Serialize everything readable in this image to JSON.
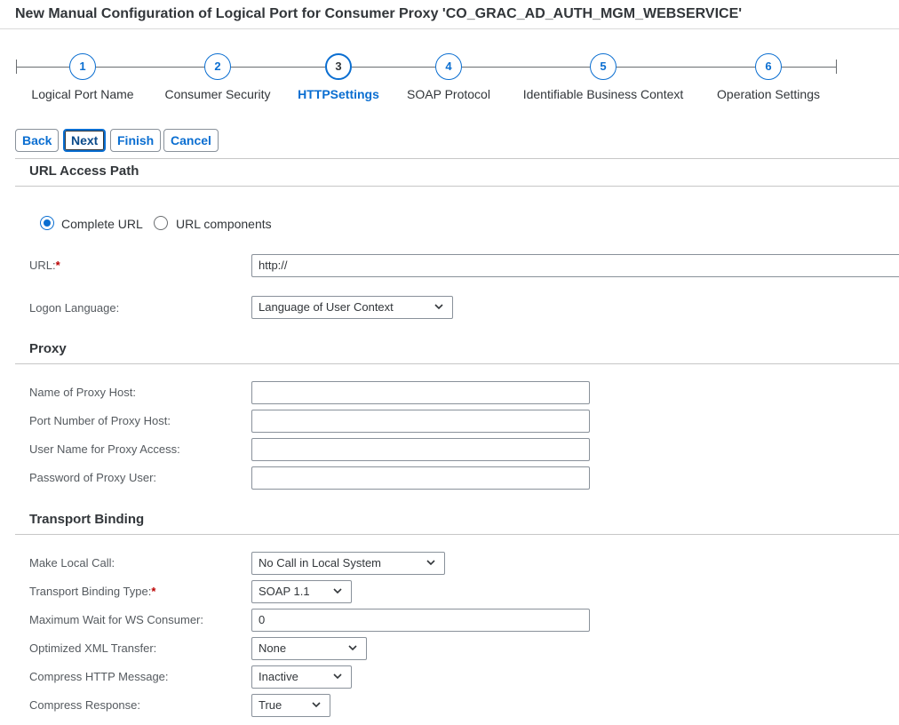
{
  "page": {
    "title": "New Manual Configuration of Logical Port for Consumer Proxy 'CO_GRAC_AD_AUTH_MGM_WEBSERVICE'"
  },
  "wizard": {
    "current_step": 3,
    "steps": [
      {
        "number": "1",
        "label": "Logical Port Name"
      },
      {
        "number": "2",
        "label": "Consumer Security"
      },
      {
        "number": "3",
        "label": "HTTPSettings"
      },
      {
        "number": "4",
        "label": "SOAP Protocol"
      },
      {
        "number": "5",
        "label": "Identifiable Business Context"
      },
      {
        "number": "6",
        "label": "Operation Settings"
      }
    ]
  },
  "toolbar": {
    "back": "Back",
    "next": "Next",
    "finish": "Finish",
    "cancel": "Cancel"
  },
  "url_access": {
    "title": "URL Access Path",
    "options": [
      "Complete URL",
      "URL components"
    ],
    "selected": "Complete URL",
    "url_label": "URL:",
    "url_required": "*",
    "url_value": "http://",
    "logon_language_label": "Logon Language:",
    "logon_language_value": "Language of User Context"
  },
  "proxy": {
    "title": "Proxy",
    "fields": [
      {
        "label": "Name of Proxy Host:",
        "value": ""
      },
      {
        "label": "Port Number of Proxy Host:",
        "value": ""
      },
      {
        "label": "User Name for Proxy Access:",
        "value": ""
      },
      {
        "label": "Password of Proxy User:",
        "value": ""
      }
    ]
  },
  "transport": {
    "title": "Transport Binding",
    "make_local_call": {
      "label": "Make Local Call:",
      "value": "No Call in Local System"
    },
    "binding_type": {
      "label": "Transport Binding Type:",
      "required": "*",
      "value": "SOAP 1.1"
    },
    "max_wait": {
      "label": "Maximum Wait for WS Consumer:",
      "value": "0"
    },
    "optimized_xml": {
      "label": "Optimized XML Transfer:",
      "value": "None"
    },
    "compress_http": {
      "label": "Compress HTTP Message:",
      "value": "Inactive"
    },
    "compress_response": {
      "label": "Compress Response:",
      "value": "True"
    }
  },
  "colors": {
    "accent": "#0a6ed1",
    "text": "#32363a",
    "required": "#bb0000"
  }
}
